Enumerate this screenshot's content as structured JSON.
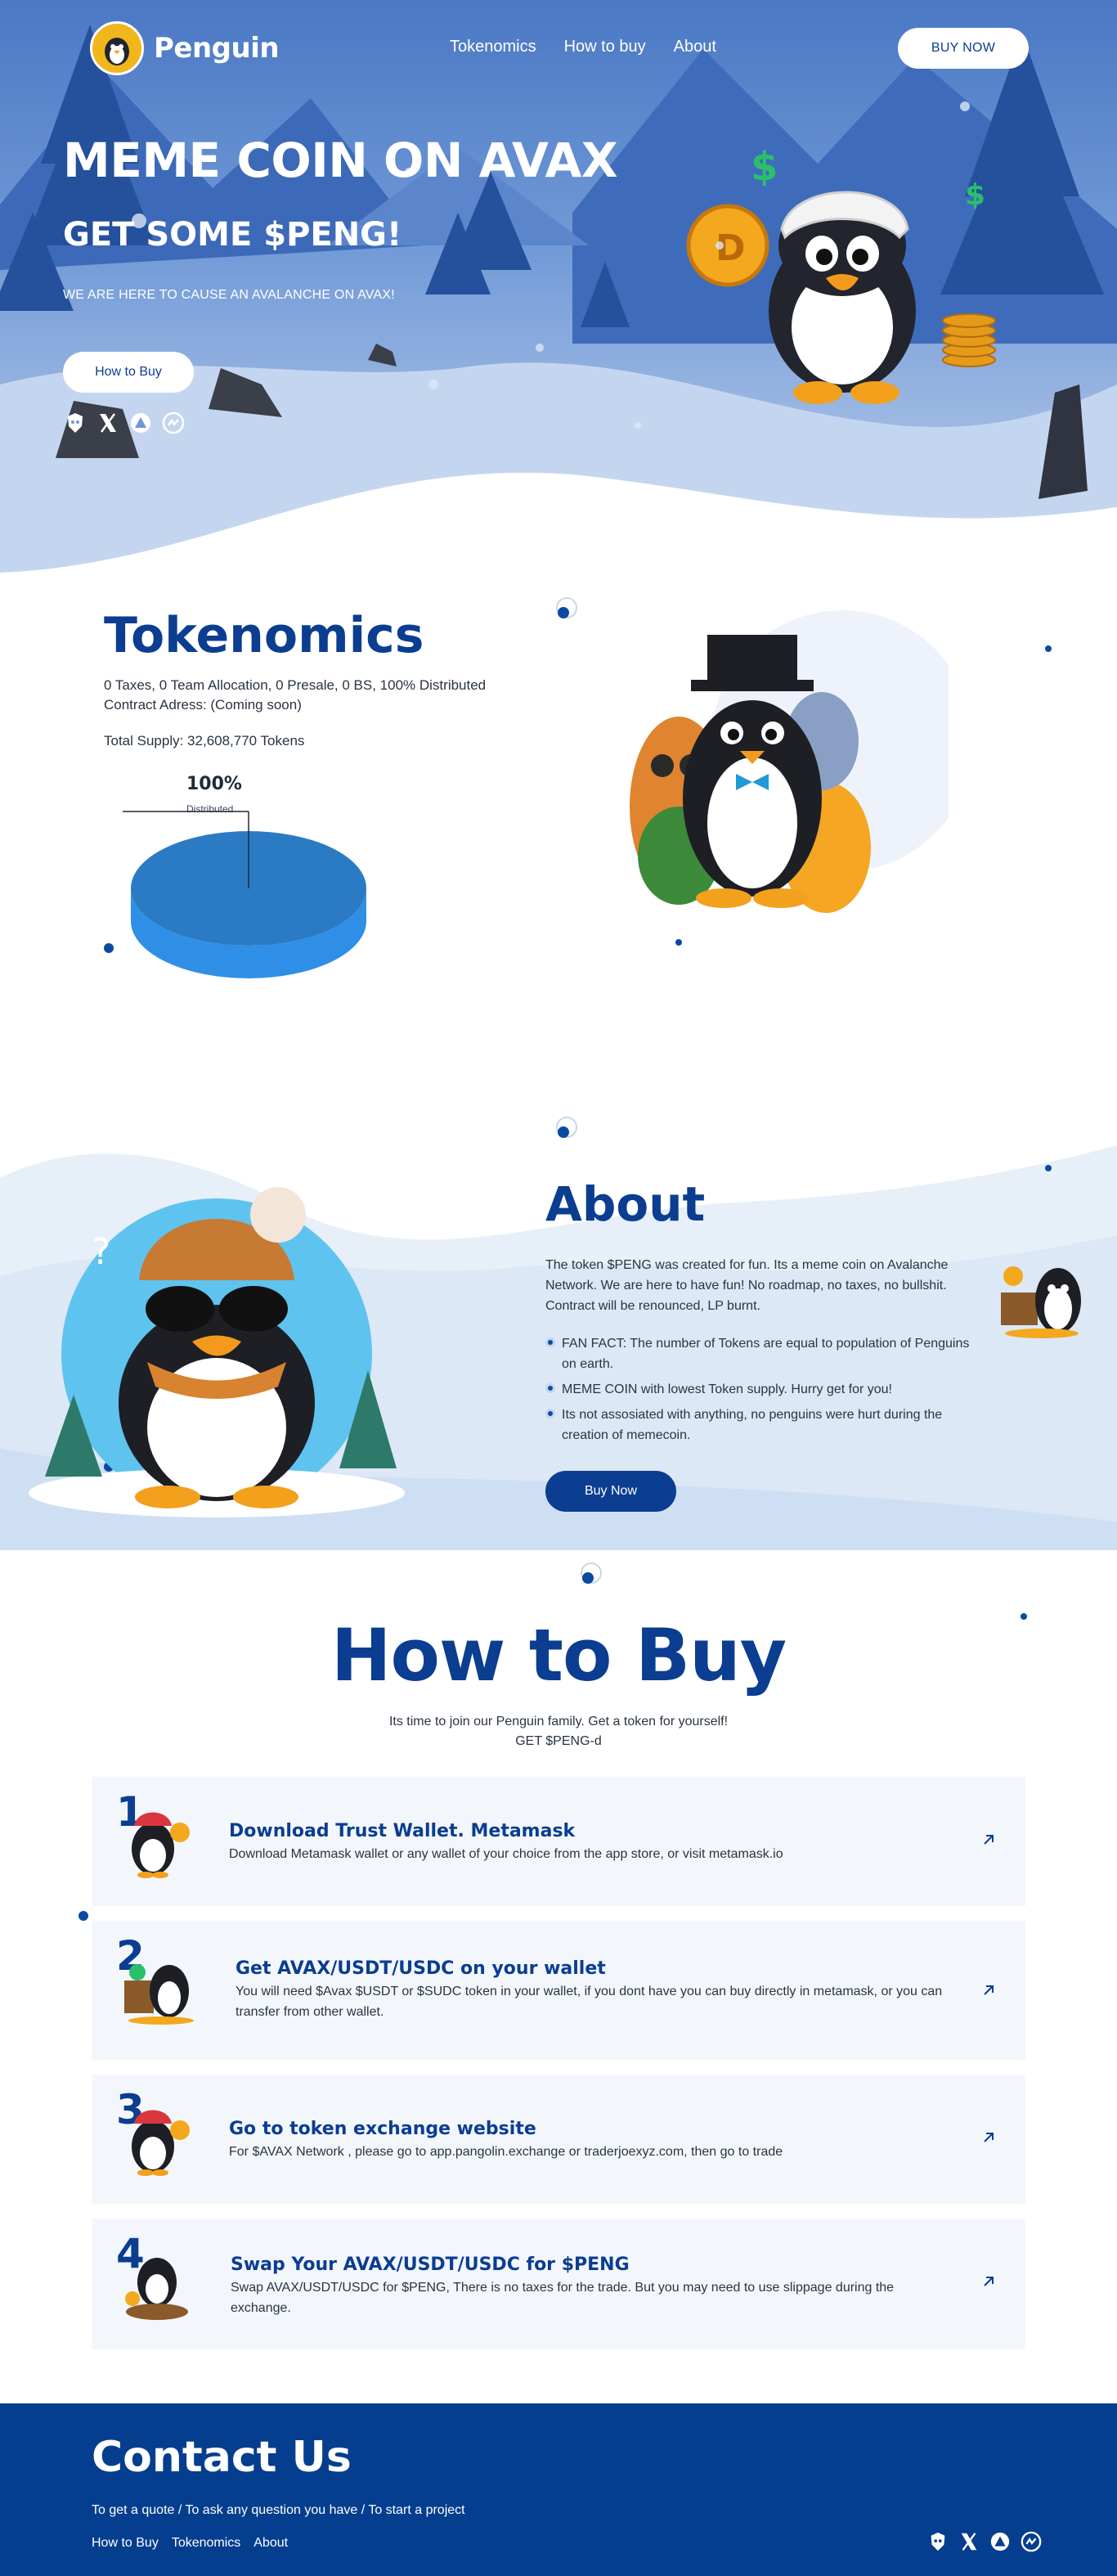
{
  "brand": {
    "name": "Penguin",
    "logo_icon": "penguin-logo-icon"
  },
  "nav": {
    "links": [
      "Tokenomics",
      "How to buy",
      "About"
    ],
    "buy_label": "BUY NOW"
  },
  "hero": {
    "title": "MEME COIN ON AVAX",
    "subtitle": "GET SOME $PENG!",
    "tagline": "WE ARE HERE TO CAUSE AN AVALANCHE ON AVAX!",
    "button_label": "How to Buy",
    "social_icons": [
      "lion-icon",
      "x-icon",
      "avalanche-icon",
      "coinmarketcap-icon"
    ]
  },
  "tokenomics": {
    "title": "Tokenomics",
    "line1": "0 Taxes, 0 Team Allocation, 0 Presale, 0 BS, 100% Distributed",
    "line2": "Contract Adress: (Coming soon)",
    "supply": "Total Supply: 32,608,770 Tokens",
    "chart_data": {
      "type": "pie",
      "categories": [
        "Distributed"
      ],
      "values": [
        100
      ],
      "value_labels": [
        "100%"
      ]
    }
  },
  "about": {
    "title": "About",
    "text": "The token $PENG was created for fun. Its a meme coin on Avalanche Network. We are here to have fun! No roadmap, no taxes, no bullshit. Contract will be renounced, LP burnt.",
    "bullets": [
      "FAN FACT: The number of Tokens are equal to population of Penguins on earth.",
      "MEME COIN with lowest Token supply. Hurry get for you!",
      "Its not assosiated with anything, no penguins were hurt during the creation of memecoin."
    ],
    "button_label": "Buy Now"
  },
  "how_to_buy": {
    "title": "How to Buy",
    "subtitle_line1": "Its time to join our Penguin family. Get a token for yourself!",
    "subtitle_line2": "GET $PENG-d",
    "steps": [
      {
        "number": "1",
        "title": "Download Trust Wallet. Metamask",
        "desc": "Download Metamask wallet or any wallet of your choice from the app store, or visit metamask.io"
      },
      {
        "number": "2",
        "title": "Get AVAX/USDT/USDC on your wallet",
        "desc": "You will need $Avax $USDT or $SUDC token in your wallet, if you dont have you can buy directly in metamask, or you can transfer from other wallet."
      },
      {
        "number": "3",
        "title": "Go to token exchange website",
        "desc": "For $AVAX Network , please go to app.pangolin.exchange or traderjoexyz.com, then go to trade"
      },
      {
        "number": "4",
        "title": "Swap Your AVAX/USDT/USDC for $PENG",
        "desc": "Swap AVAX/USDT/USDC for $PENG, There is no taxes for the trade. But you may need to use slippage during the exchange."
      }
    ]
  },
  "footer": {
    "title": "Contact Us",
    "subtitle": "To get a quote / To ask any question you have / To start a project",
    "links": [
      "How to Buy",
      "Tokenomics",
      "About"
    ]
  },
  "colors": {
    "primary": "#0b3d91",
    "footer": "#053e8e",
    "card": "#f3f7fc",
    "hero_sky": "#4a78c4"
  }
}
